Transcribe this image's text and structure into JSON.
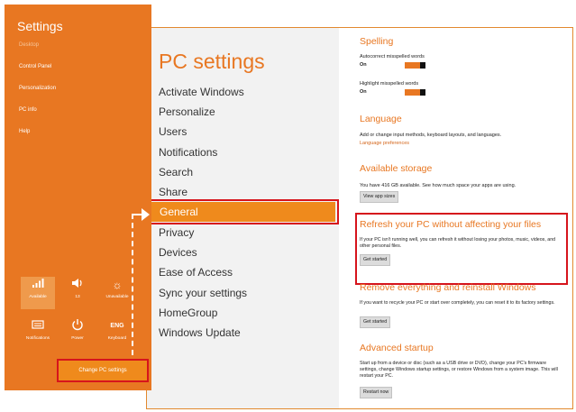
{
  "colors": {
    "accent": "#e87722",
    "highlight_border": "#d6141c",
    "selected_nav": "#ef8a1c"
  },
  "charm": {
    "title": "Settings",
    "links": [
      "Desktop",
      "Control Panel",
      "Personalization",
      "PC info",
      "Help"
    ],
    "tiles": [
      {
        "icon": "network-icon",
        "label": "Available"
      },
      {
        "icon": "volume-icon",
        "label": "13"
      },
      {
        "icon": "brightness-icon",
        "label": "Unavailable"
      },
      {
        "icon": "notifications-icon",
        "label": "Notifications"
      },
      {
        "icon": "power-icon",
        "label": "Power"
      },
      {
        "icon": "ENG",
        "label": "Keyboard"
      }
    ],
    "change_pc_settings": "Change PC settings"
  },
  "pc_settings": {
    "title": "PC settings",
    "nav": [
      "Activate Windows",
      "Personalize",
      "Users",
      "Notifications",
      "Search",
      "Share",
      "General",
      "Privacy",
      "Devices",
      "Ease of Access",
      "Sync your settings",
      "HomeGroup",
      "Windows Update"
    ],
    "selected": "General",
    "spelling": {
      "title": "Spelling",
      "autocorrect_label": "Autocorrect misspelled words",
      "autocorrect_value": "On",
      "highlight_label": "Highlight misspelled words",
      "highlight_value": "On"
    },
    "language": {
      "title": "Language",
      "desc": "Add or change input methods, keyboard layouts, and languages.",
      "link": "Language preferences"
    },
    "storage": {
      "title": "Available storage",
      "desc": "You have 416 GB available. See how much space your apps are using.",
      "button": "View app sizes"
    },
    "refresh": {
      "title": "Refresh your PC without affecting your files",
      "desc": "If your PC isn't running well, you can refresh it without losing your photos, music, videos, and other personal files.",
      "button": "Get started"
    },
    "reinstall": {
      "title": "Remove everything and reinstall Windows",
      "desc": "If you want to recycle your PC or start over completely, you can reset it to its factory settings.",
      "button": "Get started"
    },
    "advanced": {
      "title": "Advanced startup",
      "desc": "Start up from a device or disc (such as a USB drive or DVD), change your PC's firmware settings, change Windows startup settings, or restore Windows from a system image. This will restart your PC.",
      "button": "Restart now"
    }
  }
}
